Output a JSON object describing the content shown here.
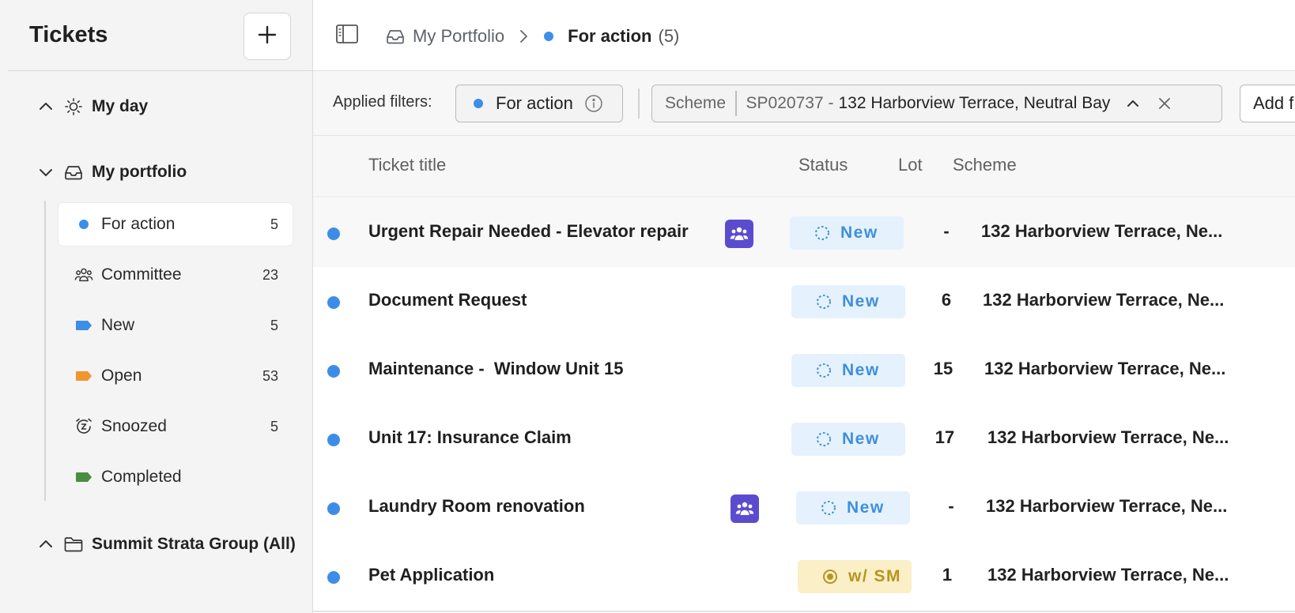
{
  "sidebar": {
    "title": "Tickets",
    "groups": [
      {
        "label": "My day",
        "chevron": "chevron-up-icon",
        "icon": "sun-icon"
      },
      {
        "label": "My portfolio",
        "chevron": "chevron-down-icon",
        "icon": "inbox-icon"
      },
      {
        "label": "Summit Strata Group (All)",
        "chevron": "chevron-up-icon",
        "icon": "folder-icon"
      }
    ],
    "items": [
      {
        "label": "For action",
        "count": "5",
        "icon": "blue-dot"
      },
      {
        "label": "Committee",
        "count": "23",
        "icon": "people-icon"
      },
      {
        "label": "New",
        "count": "5",
        "icon": "blue-tag-icon"
      },
      {
        "label": "Open",
        "count": "53",
        "icon": "orange-tag-icon"
      },
      {
        "label": "Snoozed",
        "count": "5",
        "icon": "snooze-clock-icon"
      },
      {
        "label": "Completed",
        "count": "",
        "icon": "green-tag-icon"
      }
    ]
  },
  "breadcrumb": {
    "parent": "My Portfolio",
    "current": "For action",
    "current_count": "(5)"
  },
  "filters": {
    "label": "Applied filters:",
    "for_action": "For action",
    "scheme_key": "Scheme",
    "scheme_id": "SP020737 -",
    "scheme_value": "132 Harborview Terrace, Neutral Bay",
    "add_filter": "Add f"
  },
  "table": {
    "headers": {
      "title": "Ticket title",
      "status": "Status",
      "lot": "Lot",
      "scheme": "Scheme"
    },
    "rows": [
      {
        "title": "Urgent Repair Needed - Elevator repair",
        "committee": true,
        "status": "New",
        "lot": "-",
        "scheme": "132 Harborview Terrace, Ne..."
      },
      {
        "title": "Document Request",
        "committee": false,
        "status": "New",
        "lot": "6",
        "scheme": "132 Harborview Terrace, Ne..."
      },
      {
        "title": "Maintenance -  Window Unit 15",
        "committee": false,
        "status": "New",
        "lot": "15",
        "scheme": "132 Harborview Terrace, Ne..."
      },
      {
        "title": "Unit 17: Insurance Claim",
        "committee": false,
        "status": "New",
        "lot": "17",
        "scheme": "132 Harborview Terrace, Ne..."
      },
      {
        "title": "Laundry Room renovation",
        "committee": true,
        "status": "New",
        "lot": "-",
        "scheme": "132 Harborview Terrace, Ne..."
      },
      {
        "title": "Pet Application",
        "committee": false,
        "status": "w/ SM",
        "lot": "1",
        "scheme": "132 Harborview Terrace, Ne..."
      }
    ]
  },
  "colors": {
    "accent_blue": "#3c8ee8",
    "committee_purple": "#5b4ccf",
    "new_badge_bg": "#e5f2fd",
    "new_badge_text": "#3f8fdc",
    "sm_badge_bg": "#faefc6",
    "sm_badge_text": "#b59520",
    "open_tag": "#f0962f",
    "completed_tag": "#4a8f41"
  }
}
